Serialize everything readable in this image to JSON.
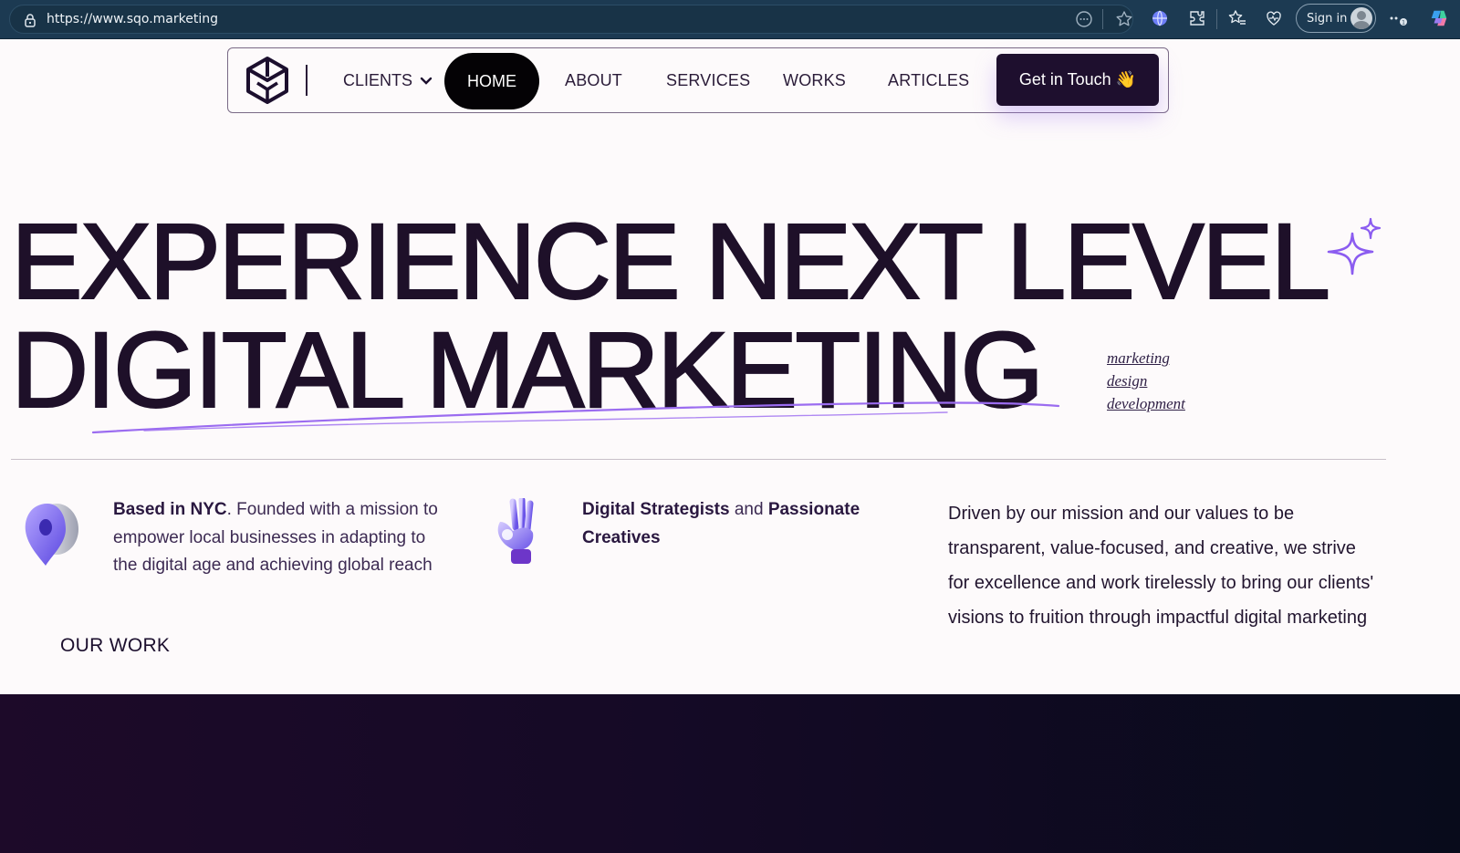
{
  "browser": {
    "url": "https://www.sqo.marketing",
    "sign_in_label": "Sign in"
  },
  "nav": {
    "clients_label": "CLIENTS",
    "home_label": "HOME",
    "about_label": "ABOUT",
    "services_label": "SERVICES",
    "works_label": "WORKS",
    "articles_label": "ARTICLES",
    "cta_label": "Get in Touch",
    "cta_emoji": "👋"
  },
  "hero": {
    "line1": "EXPERIENCE NEXT LEVEL",
    "line2": "DIGITAL MARKETING",
    "tags": [
      "marketing",
      "design",
      "development"
    ],
    "accent_color": "#9b6cf0"
  },
  "info": {
    "block1_strong": "Based in NYC",
    "block1_text": ". Founded with a mission to empower local businesses in adapting to the digital age and achieving global reach",
    "block2_strong1": "Digital Strategists",
    "block2_and": " and ",
    "block2_strong2": "Passionate Creatives",
    "block3_text": "Driven by our mission and our values to be transparent, value-focused, and creative, we strive for excellence and work tirelessly to bring our clients' visions to fruition through impactful digital marketing"
  },
  "our_work_label": "OUR WORK",
  "colors": {
    "text": "#1e1029",
    "dark_section": "#150a26",
    "browser_bar": "#1c3a52"
  }
}
